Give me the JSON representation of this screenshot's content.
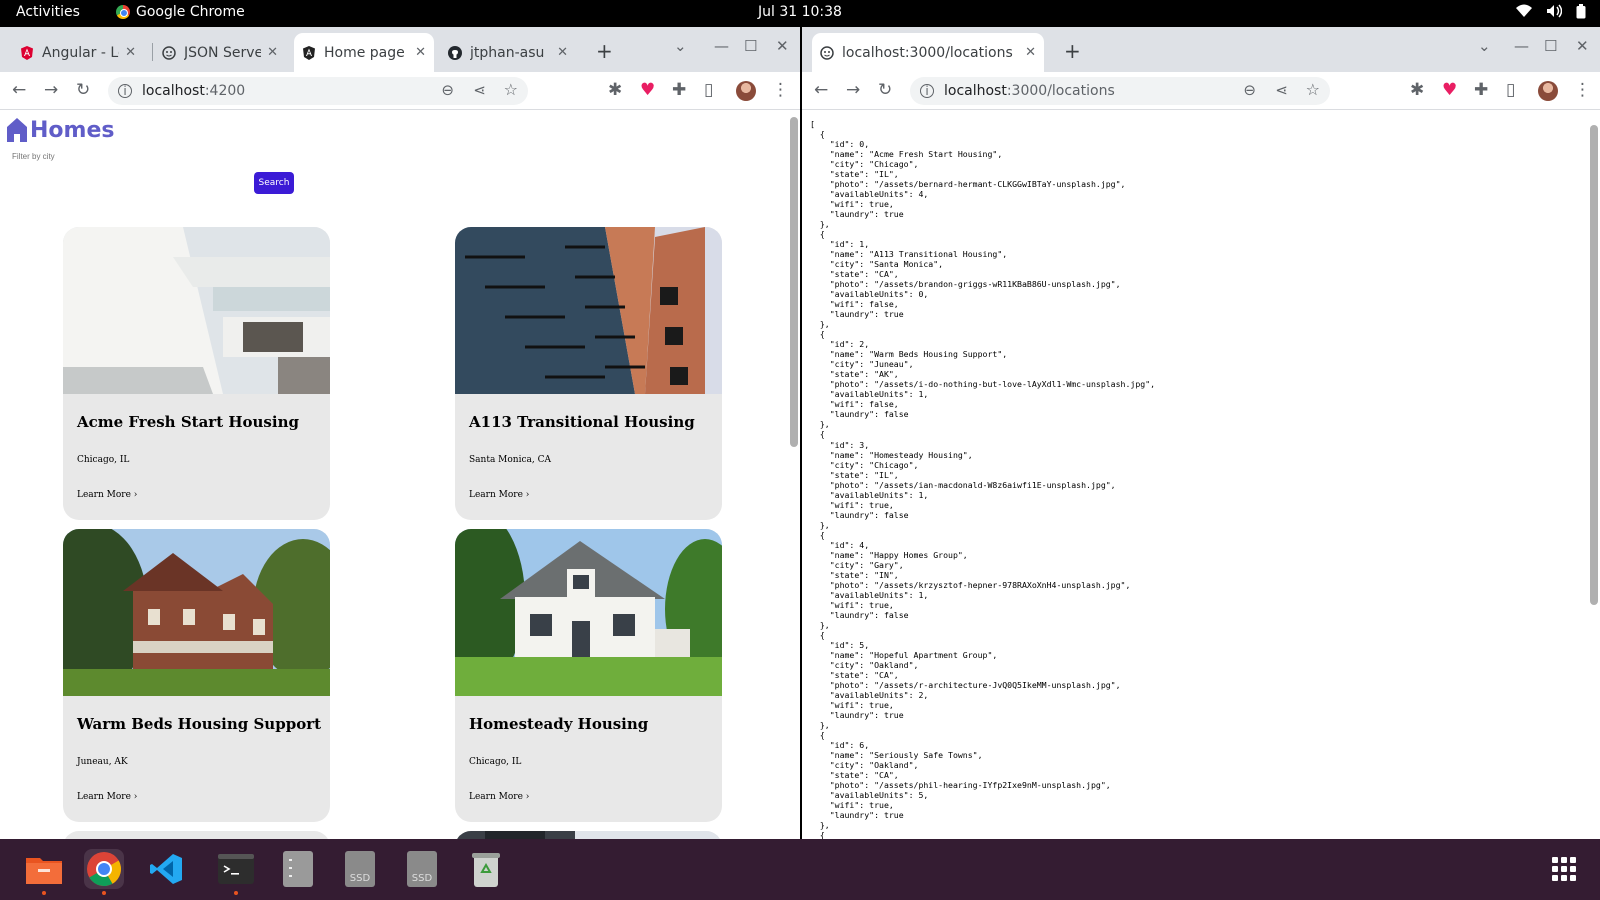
{
  "system": {
    "activities": "Activities",
    "app_name": "Google Chrome",
    "clock": "Jul 31  10:38"
  },
  "left_window": {
    "tabs": [
      {
        "label": "Angular - Le",
        "icon": "angular-icon"
      },
      {
        "label": "JSON Serve",
        "icon": "json-server-icon"
      },
      {
        "label": "Home page",
        "icon": "angular-icon"
      },
      {
        "label": "jtphan-asu",
        "icon": "github-icon"
      }
    ],
    "url_host": "localhost",
    "url_path": ":4200",
    "app": {
      "brand": "Homes",
      "filter_placeholder": "Filter by city",
      "search_label": "Search",
      "cards": [
        {
          "name": "Acme Fresh Start Housing",
          "location": "Chicago, IL",
          "more": "Learn More ›"
        },
        {
          "name": "A113 Transitional Housing",
          "location": "Santa Monica, CA",
          "more": "Learn More ›"
        },
        {
          "name": "Warm Beds Housing Support",
          "location": "Juneau, AK",
          "more": "Learn More ›"
        },
        {
          "name": "Homesteady Housing",
          "location": "Chicago, IL",
          "more": "Learn More ›"
        }
      ]
    }
  },
  "right_window": {
    "tab_label": "localhost:3000/locations",
    "url_host": "localhost",
    "url_path": ":3000/locations",
    "json_text": "[\n  {\n    \"id\": 0,\n    \"name\": \"Acme Fresh Start Housing\",\n    \"city\": \"Chicago\",\n    \"state\": \"IL\",\n    \"photo\": \"/assets/bernard-hermant-CLKGGwIBTaY-unsplash.jpg\",\n    \"availableUnits\": 4,\n    \"wifi\": true,\n    \"laundry\": true\n  },\n  {\n    \"id\": 1,\n    \"name\": \"A113 Transitional Housing\",\n    \"city\": \"Santa Monica\",\n    \"state\": \"CA\",\n    \"photo\": \"/assets/brandon-griggs-wR11KBaB86U-unsplash.jpg\",\n    \"availableUnits\": 0,\n    \"wifi\": false,\n    \"laundry\": true\n  },\n  {\n    \"id\": 2,\n    \"name\": \"Warm Beds Housing Support\",\n    \"city\": \"Juneau\",\n    \"state\": \"AK\",\n    \"photo\": \"/assets/i-do-nothing-but-love-lAyXdl1-Wmc-unsplash.jpg\",\n    \"availableUnits\": 1,\n    \"wifi\": false,\n    \"laundry\": false\n  },\n  {\n    \"id\": 3,\n    \"name\": \"Homesteady Housing\",\n    \"city\": \"Chicago\",\n    \"state\": \"IL\",\n    \"photo\": \"/assets/ian-macdonald-W8z6aiwfi1E-unsplash.jpg\",\n    \"availableUnits\": 1,\n    \"wifi\": true,\n    \"laundry\": false\n  },\n  {\n    \"id\": 4,\n    \"name\": \"Happy Homes Group\",\n    \"city\": \"Gary\",\n    \"state\": \"IN\",\n    \"photo\": \"/assets/krzysztof-hepner-978RAXoXnH4-unsplash.jpg\",\n    \"availableUnits\": 1,\n    \"wifi\": true,\n    \"laundry\": false\n  },\n  {\n    \"id\": 5,\n    \"name\": \"Hopeful Apartment Group\",\n    \"city\": \"Oakland\",\n    \"state\": \"CA\",\n    \"photo\": \"/assets/r-architecture-JvQ0Q5IkeMM-unsplash.jpg\",\n    \"availableUnits\": 2,\n    \"wifi\": true,\n    \"laundry\": true\n  },\n  {\n    \"id\": 6,\n    \"name\": \"Seriously Safe Towns\",\n    \"city\": \"Oakland\",\n    \"state\": \"CA\",\n    \"photo\": \"/assets/phil-hearing-IYfp2Ixe9nM-unsplash.jpg\",\n    \"availableUnits\": 5,\n    \"wifi\": true,\n    \"laundry\": true\n  },\n  {"
  },
  "dock": {
    "items": [
      {
        "icon": "files-icon"
      },
      {
        "icon": "chrome-icon"
      },
      {
        "icon": "vscode-icon"
      },
      {
        "icon": "terminal-icon"
      },
      {
        "icon": "drive-icon"
      },
      {
        "icon": "ssd-drive-icon",
        "label": "SSD"
      },
      {
        "icon": "ssd-drive-icon",
        "label": "SSD"
      },
      {
        "icon": "trash-icon"
      },
      {
        "icon": "app-grid-icon"
      }
    ]
  },
  "colors": {
    "brand": "#605dc8",
    "search_button": "#3b1bd6",
    "dock": "#341c32",
    "accent_dot": "#e95420"
  }
}
